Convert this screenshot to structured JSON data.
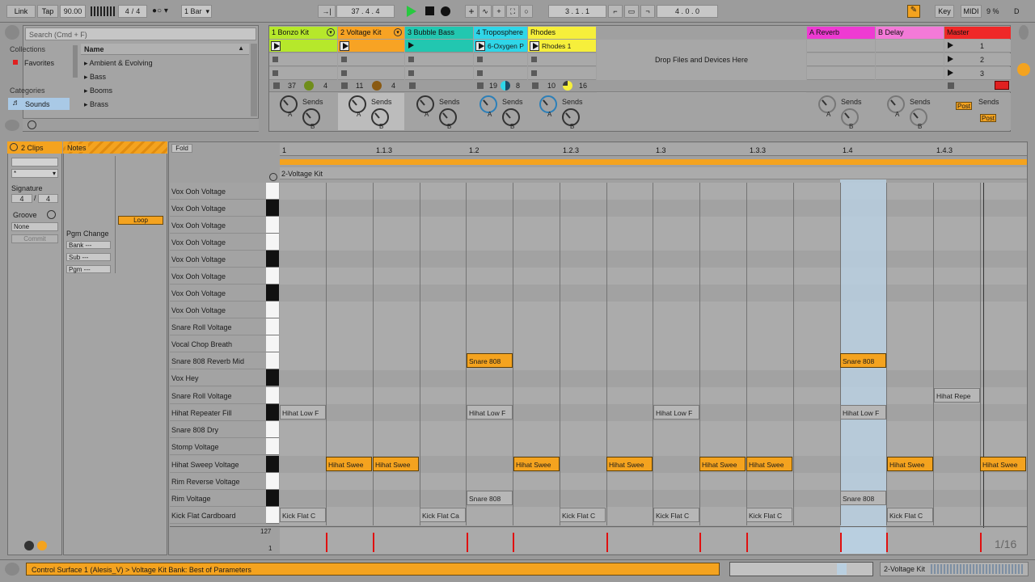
{
  "transport": {
    "link": "Link",
    "tap": "Tap",
    "tempo": "90.00",
    "sig_num": "4",
    "sig_den": "4",
    "quant": "1 Bar",
    "position": "37 .   4 .   4",
    "loop_start": "3 .   1 .   1",
    "loop_len": "4 .   0 .   0",
    "key": "Key",
    "midi": "MIDI",
    "cpu": "9 %",
    "d": "D"
  },
  "browser": {
    "search_placeholder": "Search (Cmd + F)",
    "collections_label": "Collections",
    "favorites": "Favorites",
    "categories_label": "Categories",
    "sounds": "Sounds",
    "name_header": "Name",
    "items": [
      "Ambient & Evolving",
      "Bass",
      "Booms",
      "Brass"
    ]
  },
  "tracks": [
    {
      "name": "1 Bonzo Kit",
      "color": "#b6e82b",
      "num1": "37",
      "num2": "4",
      "sends": "Sends"
    },
    {
      "name": "2 Voltage Kit",
      "color": "#f7a324",
      "num1": "11",
      "num2": "4",
      "sends": "Sends"
    },
    {
      "name": "3 Bubble Bass",
      "color": "#22c7b0",
      "num1": "",
      "num2": "",
      "sends": "Sends"
    },
    {
      "name": "4 Troposphere",
      "color": "#2fd6e8",
      "num1": "19",
      "num2": "8",
      "sends": "Sends",
      "clip": "6-Oxygen P"
    },
    {
      "name": "Rhodes",
      "color": "#f6ef3b",
      "num1": "10",
      "num2": "16",
      "sends": "Sends",
      "clip": "Rhodes 1"
    }
  ],
  "returns": [
    {
      "name": "A Reverb",
      "color": "#ee3ad2",
      "sends": "Sends"
    },
    {
      "name": "B Delay",
      "color": "#f37ad8",
      "sends": "Sends"
    },
    {
      "name": "Master",
      "color": "#ef2828",
      "sends": "Sends",
      "scenes": [
        "1",
        "2",
        "3"
      ]
    }
  ],
  "drop_text": "Drop Files and Devices Here",
  "post_label": "Post",
  "knob_a": "A",
  "knob_b": "B",
  "clip_view": {
    "clips_label": "2 Clips",
    "notes_tab": "Notes",
    "signature_label": "Signature",
    "sig_num": "4",
    "sig_den": "4",
    "groove_label": "Groove",
    "groove_value": "None",
    "commit": "Commit",
    "pgm_change": "Pgm Change",
    "bank": "Bank ---",
    "sub": "Sub ---",
    "pgm": "Pgm ---",
    "loop": "Loop",
    "fold": "Fold",
    "clip_name": "2-Voltage Kit",
    "ruler": [
      "1",
      "1.1.3",
      "1.2",
      "1.2.3",
      "1.3",
      "1.3.3",
      "1.4",
      "1.4.3"
    ],
    "vel_max": "127",
    "vel_min": "1",
    "grid": "1/16"
  },
  "rows": [
    "Vox Ooh Voltage",
    "Vox Ooh Voltage",
    "Vox Ooh Voltage",
    "Vox Ooh Voltage",
    "Vox Ooh Voltage",
    "Vox Ooh Voltage",
    "Vox Ooh Voltage",
    "Vox Ooh Voltage",
    "Snare Roll Voltage",
    "Vocal Chop Breath",
    "Snare 808 Reverb Mid",
    "Vox Hey",
    "Snare Roll Voltage",
    "Hihat Repeater Fill",
    "Snare 808 Dry",
    "Stomp Voltage",
    "Hihat Sweep Voltage",
    "Rim Reverse Voltage",
    "Rim Voltage",
    "Kick Flat Cardboard"
  ],
  "notes": {
    "snare": "Snare 808",
    "hihat_low": "Hihat Low F",
    "hihat_repe": "Hihat Repe",
    "hihat_swee": "Hihat Swee",
    "kick_c": "Kick Flat C",
    "kick_ca": "Kick Flat Ca"
  },
  "status": {
    "message": "Control Surface 1 (Alesis_V) > Voltage Kit Bank: Best of Parameters",
    "track_name": "2-Voltage Kit"
  }
}
